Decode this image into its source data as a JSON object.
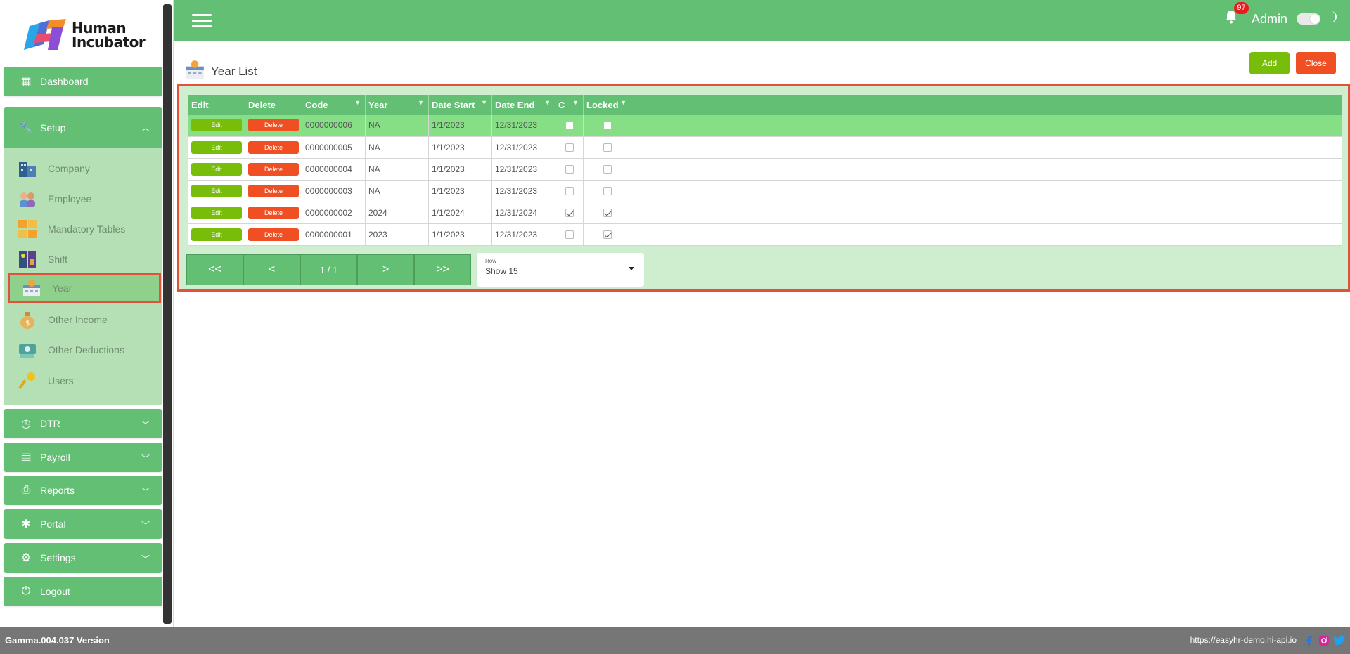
{
  "brand": {
    "line1": "Human",
    "line2": "Incubator"
  },
  "sidebar": {
    "dashboard": "Dashboard",
    "setup": "Setup",
    "setup_items": [
      {
        "label": "Company",
        "icon": "building-icon"
      },
      {
        "label": "Employee",
        "icon": "people-icon"
      },
      {
        "label": "Mandatory Tables",
        "icon": "grid-icon"
      },
      {
        "label": "Shift",
        "icon": "shift-icon"
      },
      {
        "label": "Year",
        "icon": "calendar-icon"
      },
      {
        "label": "Other Income",
        "icon": "money-bag-icon"
      },
      {
        "label": "Other Deductions",
        "icon": "deductions-icon"
      },
      {
        "label": "Users",
        "icon": "key-icon"
      }
    ],
    "dtr": "DTR",
    "payroll": "Payroll",
    "reports": "Reports",
    "portal": "Portal",
    "settings": "Settings",
    "logout": "Logout"
  },
  "header": {
    "notifications": "97",
    "user": "Admin"
  },
  "page": {
    "title": "Year List",
    "add_label": "Add",
    "close_label": "Close"
  },
  "table": {
    "columns": [
      "Edit",
      "Delete",
      "Code",
      "Year",
      "Date Start",
      "Date End",
      "C",
      "Locked"
    ],
    "edit_label": "Edit",
    "delete_label": "Delete",
    "rows": [
      {
        "code": "0000000006",
        "year": "NA",
        "start": "1/1/2023",
        "end": "12/31/2023",
        "c": false,
        "locked": false
      },
      {
        "code": "0000000005",
        "year": "NA",
        "start": "1/1/2023",
        "end": "12/31/2023",
        "c": false,
        "locked": false
      },
      {
        "code": "0000000004",
        "year": "NA",
        "start": "1/1/2023",
        "end": "12/31/2023",
        "c": false,
        "locked": false
      },
      {
        "code": "0000000003",
        "year": "NA",
        "start": "1/1/2023",
        "end": "12/31/2023",
        "c": false,
        "locked": false
      },
      {
        "code": "0000000002",
        "year": "2024",
        "start": "1/1/2024",
        "end": "12/31/2024",
        "c": true,
        "locked": true
      },
      {
        "code": "0000000001",
        "year": "2023",
        "start": "1/1/2023",
        "end": "12/31/2023",
        "c": false,
        "locked": true
      }
    ]
  },
  "pager": {
    "first": "<<",
    "prev": "<",
    "page": "1 / 1",
    "next": ">",
    "last": ">>"
  },
  "row_select": {
    "label": "Row",
    "value": "Show 15"
  },
  "footer": {
    "version": "Gamma.004.037 Version",
    "url": "https://easyhr-demo.hi-api.io"
  },
  "colors": {
    "accent": "#63bf73",
    "add": "#77bd0a",
    "close": "#f04e23",
    "highlight": "#e0533a"
  }
}
